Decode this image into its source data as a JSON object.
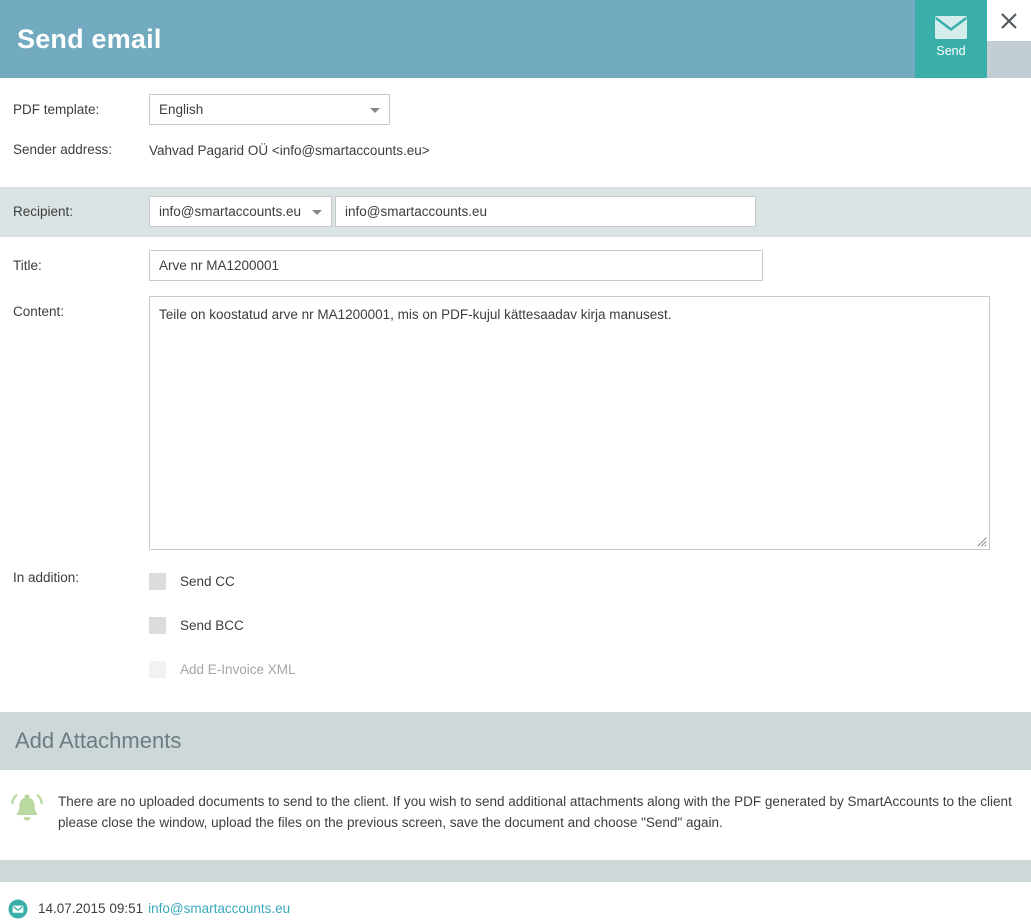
{
  "window": {
    "title": "Send email",
    "send_label": "Send",
    "send_icon": "envelope-icon",
    "close_icon": "close-icon"
  },
  "form": {
    "pdf_template": {
      "label": "PDF template:",
      "value": "English",
      "caret_icon": "chevron-down-icon"
    },
    "sender_address": {
      "label": "Sender address:",
      "value": "Vahvad Pagarid OÜ <info@smartaccounts.eu>"
    },
    "recipient": {
      "label": "Recipient:",
      "select_value": "info@smartaccounts.eu",
      "input_value": "info@smartaccounts.eu",
      "input_placeholder": "",
      "caret_icon": "chevron-down-icon"
    },
    "title": {
      "label": "Title:",
      "value": "Arve nr MA1200001",
      "placeholder": ""
    },
    "content": {
      "label": "Content:",
      "value": "Teile on koostatud arve nr MA1200001, mis on PDF-kujul kättesaadav kirja manusest.",
      "placeholder": ""
    },
    "in_addition": {
      "label": "In addition:",
      "options": [
        {
          "label": "Send CC",
          "checked": false,
          "disabled": false
        },
        {
          "label": "Send BCC",
          "checked": false,
          "disabled": false
        },
        {
          "label": "Add E-Invoice XML",
          "checked": false,
          "disabled": true
        }
      ]
    }
  },
  "attachments": {
    "header": "Add Attachments",
    "icon": "bell-icon",
    "note": "There are no uploaded documents to send to the client. If you wish to send additional attachments along with the PDF generated by SmartAccounts to the client please close the window, upload the files on the previous screen, save the document and choose \"Send\" again."
  },
  "footer": {
    "icon": "mail-circle-icon",
    "timestamp": "14.07.2015 09:51",
    "email": "info@smartaccounts.eu"
  },
  "colors": {
    "header_bg": "#72abbf",
    "send_bg": "#3aafa9",
    "row_highlight": "#d9e3e3",
    "section_bg": "#ced8d9",
    "link": "#3aa9bd",
    "bell_green": "#b9d9a0"
  }
}
